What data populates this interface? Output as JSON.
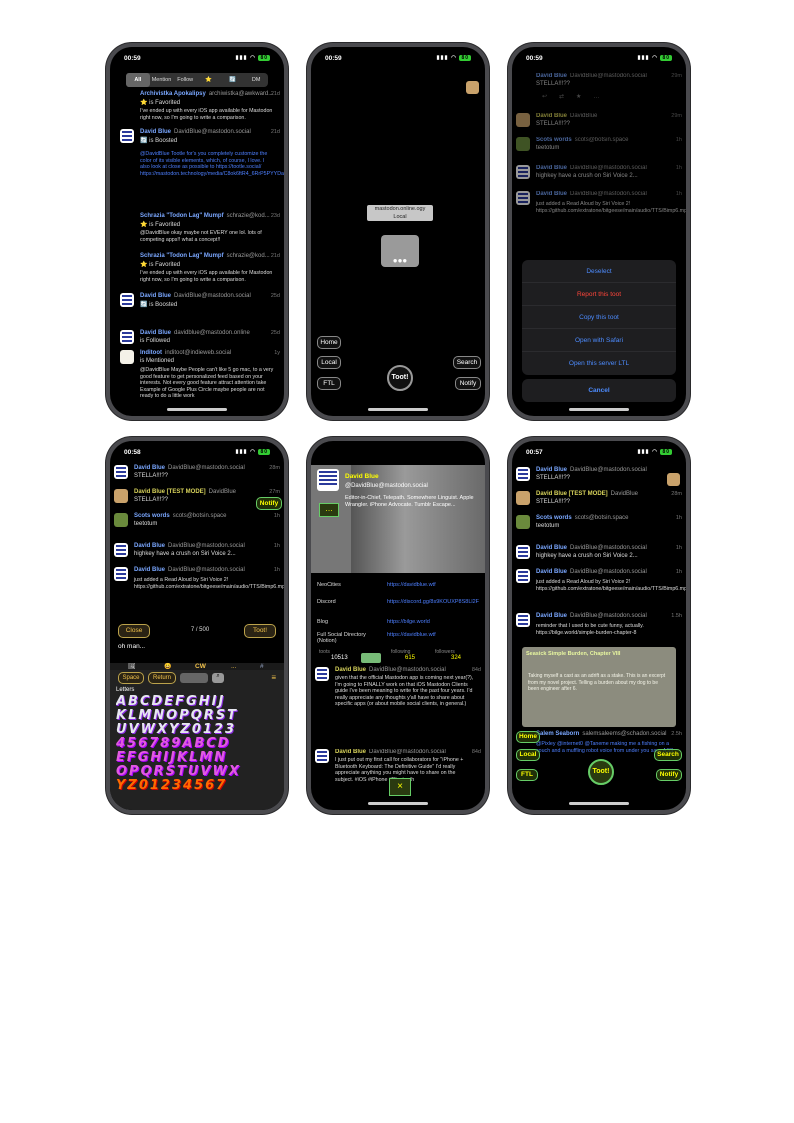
{
  "status": {
    "time_a": "00:59",
    "time_b": "00:58",
    "time_c": "00:57",
    "battery": "80"
  },
  "p1": {
    "tabs": [
      "All",
      "Mention",
      "Follow",
      "⭐",
      "🔄",
      "DM"
    ],
    "posts": [
      {
        "name": "Archivistka Apokalipsy",
        "handle": "archiwistka@awkward...",
        "time": "21d",
        "sub": "⭐ is Favorited",
        "body": "I've ended up with every iOS app available for Mastodon right now, so I'm going to write a comparison."
      },
      {
        "name": "David Blue",
        "handle": "DavidBlue@mastodon.social",
        "time": "21d",
        "sub": "🔄 is Boosted",
        "body": "@DavidBlue Tootle for's you completely customize the color of its visible elements, which, of course, I love. I also look at close as possible to https://tootle.social/ https://mastodon.technology/media/C8ok6ftR4_6RrP5PYYDa"
      },
      {
        "name": "Schrazia \"Todon Lag\" Mumpf",
        "handle": "schrazie@kod...",
        "time": "23d",
        "sub": "⭐ is Favorited",
        "body": "@DavidBlue okay maybe not EVERY one lol. lots of competing apps!! what a concept!!"
      },
      {
        "name": "Schrazia \"Todon Lag\" Mumpf",
        "handle": "schrazie@kod...",
        "time": "21d",
        "sub": "⭐ is Favorited",
        "body": "I've ended up with every iOS app available for Mastodon right now, so I'm going to write a comparison."
      },
      {
        "name": "David Blue",
        "handle": "DavidBlue@mastodon.social",
        "time": "25d",
        "sub": "🔄 is Boosted",
        "body": ""
      },
      {
        "name": "David Blue",
        "handle": "davidblue@mastodon.online",
        "time": "25d",
        "sub": "is Followed",
        "body": ""
      },
      {
        "name": "Inditoot",
        "handle": "inditoot@indieweb.social",
        "time": "1y",
        "sub": "is Mentioned",
        "body": "@DavidBlue Maybe People can't like 5 go mac, to a very good feature to get personalized feed based on your interests. Not every good feature attract attention take Example of Google Plus Circle maybe people are not ready to do a little work"
      }
    ]
  },
  "p2": {
    "server": "mastodon.online.ogy",
    "scope": "Local",
    "buttons": {
      "home": "Home",
      "local": "Local",
      "ftl": "FTL",
      "toot": "Toot!",
      "search": "Search",
      "notify": "Notify"
    }
  },
  "p3": {
    "posts": [
      {
        "name": "David Blue",
        "handle": "DavidBlue@mastodon.social",
        "time": "29m",
        "body": "STELLA!!!??"
      },
      {
        "name": "David Blue",
        "handle": "DavidBlue",
        "time": "29m",
        "body": "STELLA!!!??"
      },
      {
        "name": "Scots words",
        "handle": "scots@botsin.space",
        "time": "1h",
        "body": "teetotum"
      },
      {
        "name": "David Blue",
        "handle": "DavidBlue@mastodon.social",
        "time": "1h",
        "body": "highkey have a crush on Siri Voice 2..."
      },
      {
        "name": "David Blue",
        "handle": "DavidBlue@mastodon.social",
        "time": "1h",
        "body": "just added a Read Aloud by Siri Voice 2! https://github.com/extratone/bitgeese/main/audio/TTS/Bimp6.mp3"
      }
    ],
    "menu": [
      "Deselect",
      "Report this toot",
      "Copy this toot",
      "Open with Safari",
      "Open this server LTL",
      "Cancel"
    ]
  },
  "p4": {
    "posts": [
      {
        "name": "David Blue",
        "handle": "DavidBlue@mastodon.social",
        "time": "28m",
        "body": "STELLA!!!??"
      },
      {
        "name": "David Blue [TEST MODE]",
        "handle": "DavidBlue",
        "time": "27m",
        "body": "STELLA!!!??"
      },
      {
        "name": "Scots words",
        "handle": "scots@botsin.space",
        "time": "1h",
        "body": "teetotum"
      },
      {
        "name": "David Blue",
        "handle": "DavidBlue@mastodon.social",
        "time": "1h",
        "body": "highkey have a crush on Siri Voice 2..."
      },
      {
        "name": "David Blue",
        "handle": "DavidBlue@mastodon.social",
        "time": "1h",
        "body": "just added a Read Aloud by Siri Voice 2! https://github.com/extratone/bitgeese/main/audio/TTS/Bimp6.mp3"
      }
    ],
    "notify": "Notify",
    "close": "Close",
    "counter": "7 / 500",
    "toot": "Toot!",
    "draft": "oh man...",
    "toolbar": [
      "🖼",
      "😀",
      "CW",
      "...",
      "#"
    ],
    "keys": {
      "space": "Space",
      "return": "Return"
    },
    "kb_label": "Letters",
    "rows": [
      "ABCDEFGHIJ",
      "KLMNOPQRST",
      "UVWXYZ0123",
      "456789ABCD",
      "EFGHIJKLMN",
      "OPQRSTUVWX",
      "YZ01234567"
    ]
  },
  "p5": {
    "name": "David Blue",
    "handle": "@DavidBlue@mastodon.social",
    "bio": "Editor-in-Chief, Telepath. Somewhere Linguist. Apple Wrangler. iPhone Advocate. Tumblr Escape...",
    "fields": [
      {
        "k": "NeoCities",
        "v": "https://davidblue.wtf"
      },
      {
        "k": "Discord",
        "v": "https://discord.gg/8s9KOUXP8S8Ll2F"
      },
      {
        "k": "Blog",
        "v": "https://bilge.world"
      },
      {
        "k": "Full Social Directory (Notion)",
        "v": "https://davidblue.wtf"
      }
    ],
    "stats": {
      "toots_label": "toots",
      "toots": "10513",
      "following_label": "following",
      "following": "615",
      "followers_label": "followers",
      "followers": "324"
    },
    "posts": [
      {
        "name": "David Blue",
        "handle": "DavidBlue@mastodon.social",
        "time": "84d",
        "body": "given that the official Mastodon app is coming next year(?), I'm going to FINALLY work on that iOS Mastodon Clients guide I've been meaning to write for the past four years. I'd really appreciate any thoughts y'all have to share about specific apps (or about mobile social clients, in general.)"
      },
      {
        "name": "David Blue",
        "handle": "DavidBlue@mastodon.social",
        "time": "84d",
        "body": "I just put out my first call for collaborators for \"iPhone + Bluetooth Keyboard: The Definitive Guide\" I'd really appreciate anything you might have to share on the subject. #iOS #iPhone #Bluetooth"
      }
    ],
    "close": "×"
  },
  "p6": {
    "posts": [
      {
        "name": "David Blue",
        "handle": "DavidBlue@mastodon.social",
        "time": "29m",
        "body": "STELLA!!!??"
      },
      {
        "name": "David Blue [TEST MODE]",
        "handle": "DavidBlue",
        "time": "28m",
        "body": "STELLA!!!??"
      },
      {
        "name": "Scots words",
        "handle": "scots@botsin.space",
        "time": "1h",
        "body": "teetotum"
      },
      {
        "name": "David Blue",
        "handle": "DavidBlue@mastodon.social",
        "time": "1h",
        "body": "highkey have a crush on Siri Voice 2..."
      },
      {
        "name": "David Blue",
        "handle": "DavidBlue@mastodon.social",
        "time": "1h",
        "body": "just added a Read Aloud by Siri Voice 2! https://github.com/extratone/bitgeese/main/audio/TTS/Bimp6.mp3"
      },
      {
        "name": "David Blue",
        "handle": "DavidBlue@mastodon.social",
        "time": "1.5h",
        "body": "reminder that I used to be cute funny, actually. https://bilge.world/simple-burden-chapter-8"
      }
    ],
    "card_title": "Seasick Simple Burden, Chapter VIII",
    "card_body": "Taking myself a cast as an adrift as a stake. This is an excerpt from my novel project. Telling a burden about my dog to be been engineer after 6.",
    "last": {
      "name": "Salem Seaborn",
      "handle": "salemsaleems@schadon.social",
      "time": "2.5h",
      "body": "@Pixley @internet0 @Taneme making me a fishing on a couch and a muffling robot voice from under you says ASS"
    },
    "buttons": {
      "home": "Home",
      "local": "Local",
      "ftl": "FTL",
      "toot": "Toot!",
      "search": "Search",
      "notify": "Notify"
    }
  }
}
